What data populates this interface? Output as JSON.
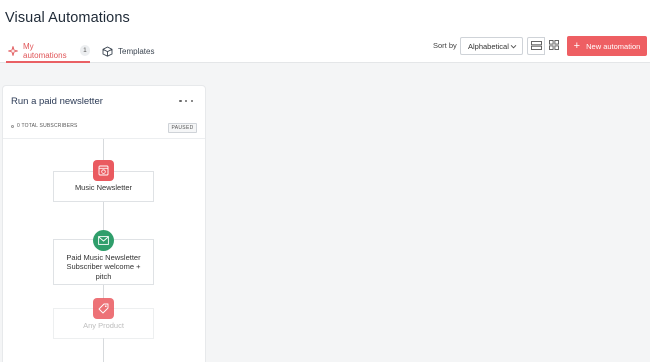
{
  "header": {
    "title": "Visual Automations"
  },
  "tabs": [
    {
      "label": "My automations",
      "count": "1",
      "icon": "sparkle-icon",
      "active": true
    },
    {
      "label": "Templates",
      "icon": "cube-icon",
      "active": false
    }
  ],
  "toolbar": {
    "sort_label": "Sort by",
    "sort_value": "Alphabetical",
    "view_modes": [
      "list-view-icon",
      "grid-view-icon"
    ],
    "new_button_label": "New automation",
    "accent_color": "#ee5f63"
  },
  "card": {
    "title": "Run a paid newsletter",
    "subscribers": "0 TOTAL SUBSCRIBERS",
    "status": "PAUSED",
    "nodes": [
      {
        "label": "Music Newsletter",
        "icon": "newsletter-icon",
        "color": "#ea5a60"
      },
      {
        "label": "Paid Music Newsletter Subscriber welcome + pitch",
        "icon": "email-icon",
        "color": "#2f9e6b"
      },
      {
        "label": "Any Product",
        "icon": "tag-icon",
        "color": "#ea5a60"
      }
    ]
  }
}
